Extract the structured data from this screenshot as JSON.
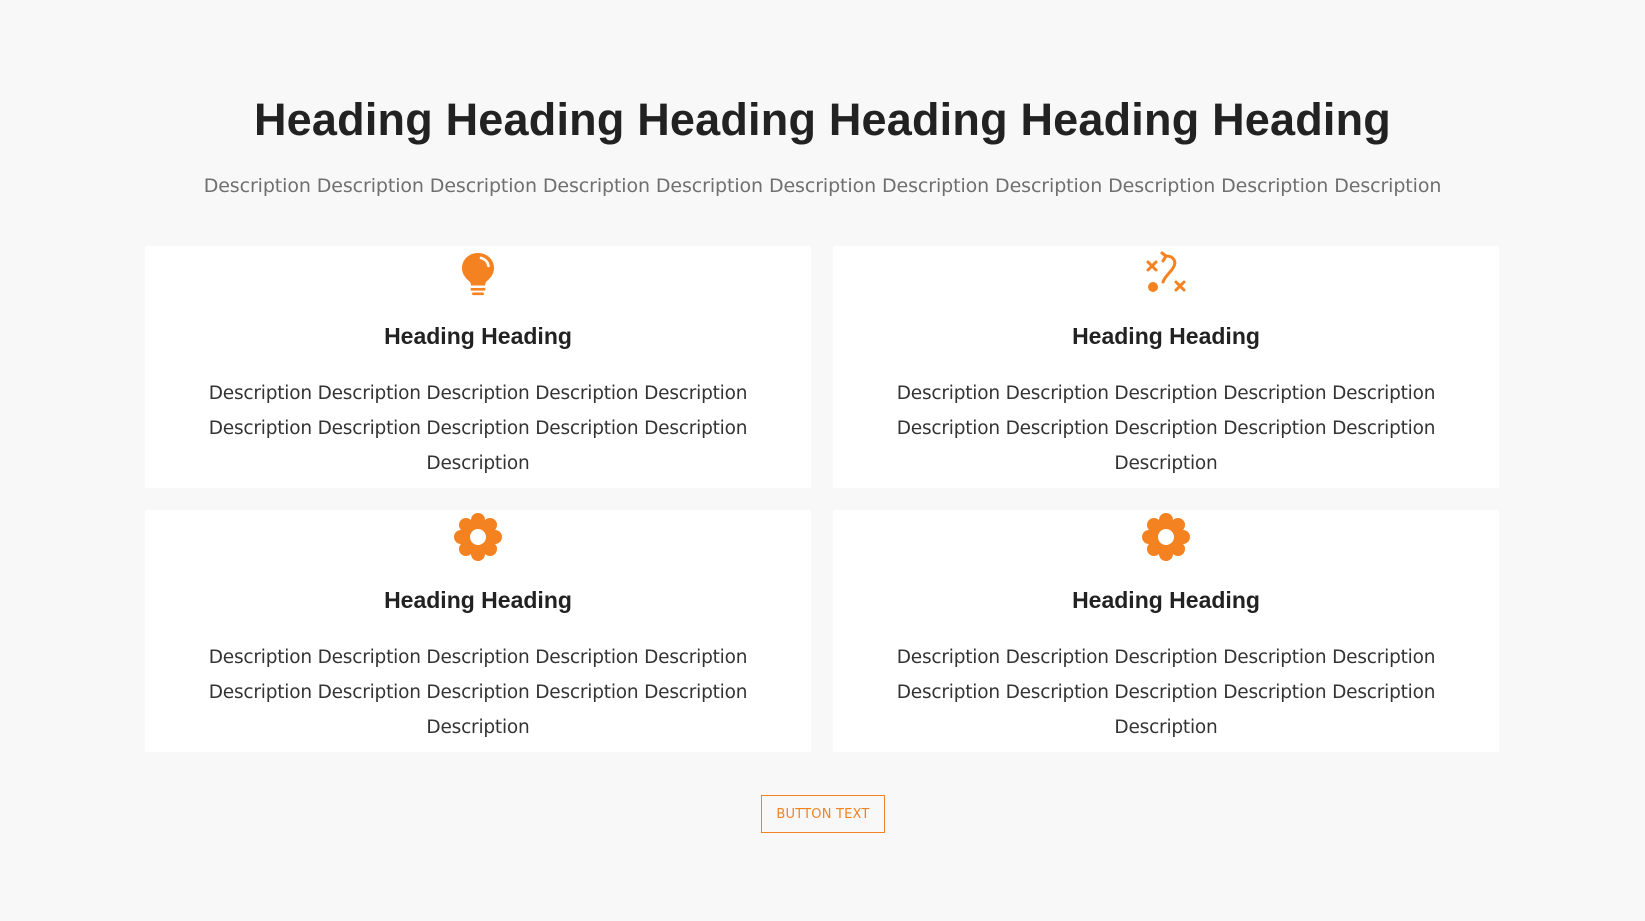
{
  "hero": {
    "title": "Heading Heading Heading Heading Heading Heading",
    "description": "Description Description Description Description Description Description Description Description Description Description Description"
  },
  "cards": [
    {
      "icon": "lightbulb-icon",
      "title": "Heading Heading",
      "description": "Description Description Description Description Description Description Description Description Description Description Description"
    },
    {
      "icon": "strategy-icon",
      "title": "Heading Heading",
      "description": "Description Description Description Description Description Description Description Description Description Description Description"
    },
    {
      "icon": "gear-icon",
      "title": "Heading Heading",
      "description": "Description Description Description Description Description Description Description Description Description Description Description"
    },
    {
      "icon": "gear-icon",
      "title": "Heading Heading",
      "description": "Description Description Description Description Description Description Description Description Description Description Description"
    }
  ],
  "button": {
    "label": "BUTTON TEXT"
  },
  "colors": {
    "accent": "#f58220",
    "background": "#f8f8f8",
    "card": "#ffffff",
    "heading": "#222222",
    "muted": "#6f6f6f"
  }
}
